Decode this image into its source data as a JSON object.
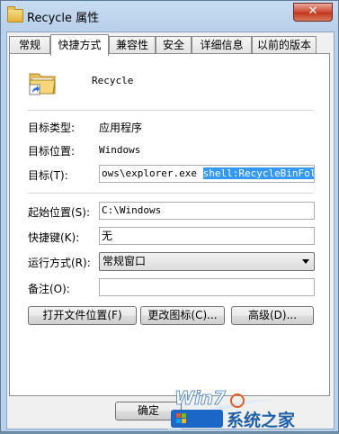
{
  "window": {
    "title": "Recycle 属性",
    "close_glyph": "✕"
  },
  "tabs": [
    {
      "label": "常规"
    },
    {
      "label": "快捷方式",
      "active": true
    },
    {
      "label": "兼容性"
    },
    {
      "label": "安全"
    },
    {
      "label": "详细信息"
    },
    {
      "label": "以前的版本"
    }
  ],
  "shortcut": {
    "name": "Recycle",
    "icon": "folder-shortcut-icon",
    "target_type_label": "目标类型:",
    "target_type_value": "应用程序",
    "target_location_label": "目标位置:",
    "target_location_value": "Windows",
    "target_label": "目标(T):",
    "target_value_plain": "ows\\explorer.exe ",
    "target_value_selected": "shell:RecycleBinFolder",
    "start_in_label": "起始位置(S):",
    "start_in_value": "C:\\Windows",
    "shortcut_key_label": "快捷键(K):",
    "shortcut_key_value": "无",
    "run_label": "运行方式(R):",
    "run_value": "常规窗口",
    "comment_label": "备注(O):",
    "comment_value": ""
  },
  "buttons": {
    "open_location": "打开文件位置(F)",
    "change_icon": "更改图标(C)...",
    "advanced": "高级(D)...",
    "ok": "确定"
  },
  "watermark": {
    "text": "系统之家",
    "logo": "Win7"
  }
}
